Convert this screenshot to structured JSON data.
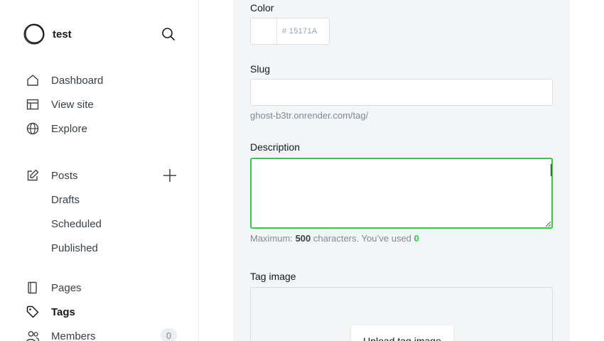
{
  "site": {
    "name": "test"
  },
  "nav": {
    "dashboard": "Dashboard",
    "view_site": "View site",
    "explore": "Explore",
    "posts": "Posts",
    "drafts": "Drafts",
    "scheduled": "Scheduled",
    "published": "Published",
    "pages": "Pages",
    "tags": "Tags",
    "members": "Members",
    "members_count": "0"
  },
  "form": {
    "color_label": "Color",
    "color_value": "# 15171A",
    "slug_label": "Slug",
    "slug_value": "",
    "slug_hint": "ghost-b3tr.onrender.com/tag/",
    "description_label": "Description",
    "description_value": "",
    "limit_prefix": "Maximum: ",
    "limit_max": "500",
    "limit_middle": " characters. You’ve used ",
    "limit_used": "0",
    "tag_image_label": "Tag image",
    "upload_button": "Upload tag image"
  },
  "colors": {
    "accent": "#30cf43",
    "text": "#15171a",
    "muted": "#7c8b9a",
    "panel": "#f4f5f6"
  },
  "icons": [
    "ghost-logo-icon",
    "search-icon",
    "home-icon",
    "view-site-icon",
    "globe-icon",
    "edit-icon",
    "plus-icon",
    "page-icon",
    "tag-icon",
    "members-icon"
  ]
}
